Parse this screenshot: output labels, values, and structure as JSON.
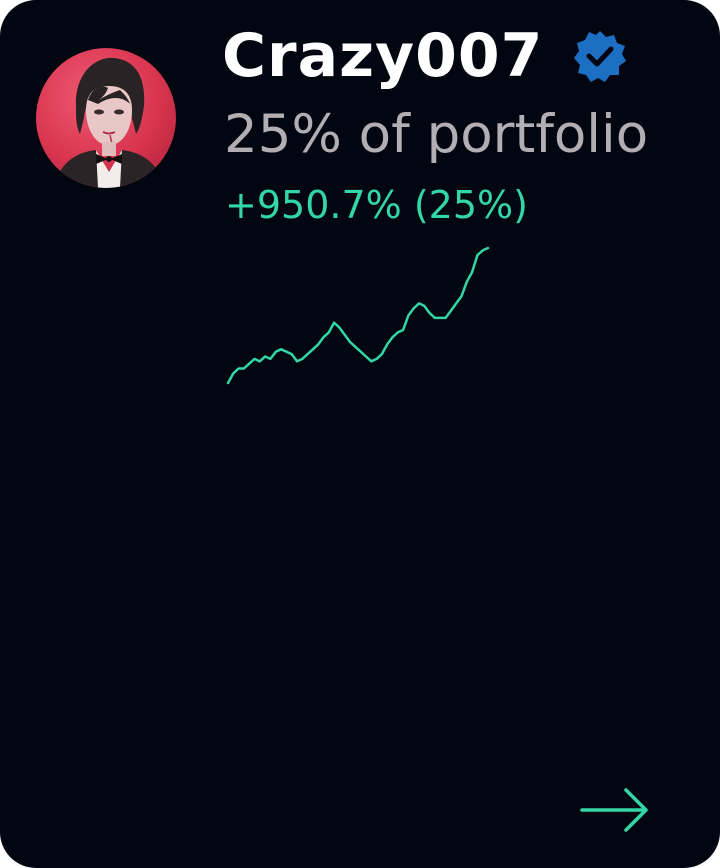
{
  "profile": {
    "name": "Crazy007",
    "verified": true,
    "portfolio_share_text": "25% of portfolio",
    "gain_text": "+950.7% (25%)",
    "avatar": "person-avatar"
  },
  "colors": {
    "card_background": "#020611",
    "name": "#ffffff",
    "subtitle": "#b2aeb4",
    "positive": "#33d6a6",
    "verified_badge": "#1d6fc4",
    "avatar_background": "#d8344e"
  },
  "icons": {
    "verified": "verified-badge-icon",
    "next": "arrow-right-icon"
  },
  "chart_data": {
    "type": "line",
    "title": "",
    "xlabel": "",
    "ylabel": "",
    "axes_visible": false,
    "grid": false,
    "legend": "none",
    "series": [
      {
        "values": [
          0,
          4,
          6,
          6,
          8,
          10,
          9,
          11,
          10,
          13,
          14,
          13,
          12,
          9,
          10,
          12,
          14,
          16,
          19,
          21,
          25,
          23,
          20,
          17,
          15,
          13,
          11,
          9,
          10,
          12,
          16,
          19,
          21,
          22,
          28,
          31,
          33,
          32,
          29,
          27,
          27,
          27,
          30,
          33,
          36,
          42,
          46,
          53,
          55,
          56
        ]
      }
    ]
  }
}
